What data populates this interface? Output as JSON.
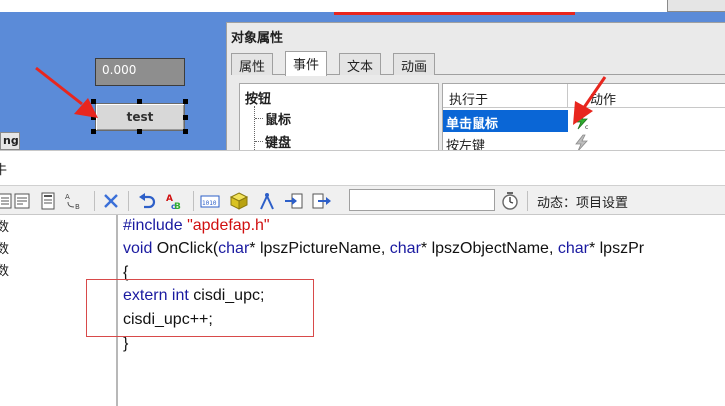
{
  "canvas": {
    "io_field_value": "0.000",
    "button_label": "test",
    "side_stub_label": "ng"
  },
  "props_dialog": {
    "title": "对象属性",
    "tabs": [
      "属性",
      "事件",
      "文本",
      "动画"
    ],
    "active_tab": "事件",
    "tree": {
      "root": "按钮",
      "items": [
        "鼠标",
        "键盘"
      ]
    },
    "events_table": {
      "headers": [
        "执行于",
        "动作"
      ],
      "rows": [
        "单击鼠标",
        "按左键"
      ],
      "selected_row": "单击鼠标"
    }
  },
  "editor": {
    "title_fragment": "牛",
    "dynamic_label": "动态：项目设置",
    "function_list": [
      "数",
      "数",
      "数"
    ],
    "code": {
      "line1_directive": "#include",
      "line1_string": "\"apdefap.h\"",
      "line2_void": "void",
      "line2_name": " OnClick(",
      "line2_char1": "char",
      "line2_p1": "* lpszPictureName, ",
      "line2_char2": "char",
      "line2_p2": "* lpszObjectName, ",
      "line2_char3": "char",
      "line2_p3": "* lpszPr",
      "line3": "{",
      "line4_kw1": "extern",
      "line4_kw2": "int",
      "line4_rest": " cisdi_upc;",
      "line5": "cisdi_upc++;",
      "line6": "}"
    }
  },
  "colors": {
    "canvas_bg": "#5b8bd8",
    "selected_row": "#0a66d6",
    "annotation_red": "#e8261e",
    "keyword_blue": "#1a1aa0",
    "string_red": "#d01010"
  }
}
